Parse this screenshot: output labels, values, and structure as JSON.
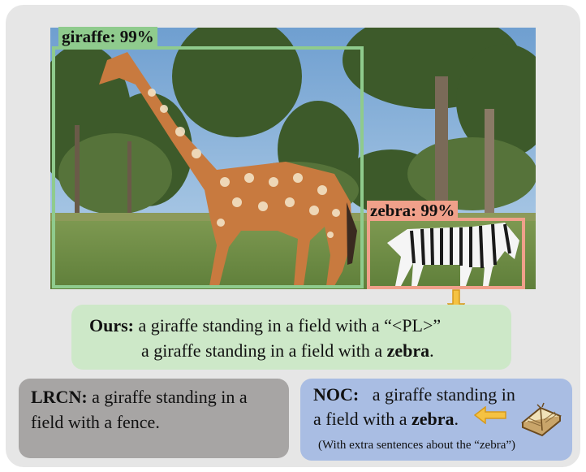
{
  "detections": [
    {
      "label": "giraffe: 99%",
      "color": "#8fcb8d"
    },
    {
      "label": "zebra: 99%",
      "color": "#f0a08a"
    }
  ],
  "ours": {
    "label": "Ours:",
    "line1": "a giraffe standing in a field with a “<PL>”",
    "line2_text": "a giraffe standing in a field with a",
    "line2_bold": "zebra",
    "line2_end": ".",
    "color": "#cde8c8"
  },
  "lrcn": {
    "label": "LRCN:",
    "line1": "a giraffe standing in a",
    "line2": "field with a fence.",
    "color": "#a7a5a4"
  },
  "noc": {
    "label": "NOC:",
    "line1": "a giraffe standing in",
    "line2_text": "a field with a",
    "line2_bold": "zebra",
    "line2_end": ".",
    "note": "(With extra sentences about the “zebra”)",
    "color": "#a9bde3"
  },
  "icons": [
    "down-arrow-icon",
    "left-arrow-icon",
    "book-icon"
  ]
}
